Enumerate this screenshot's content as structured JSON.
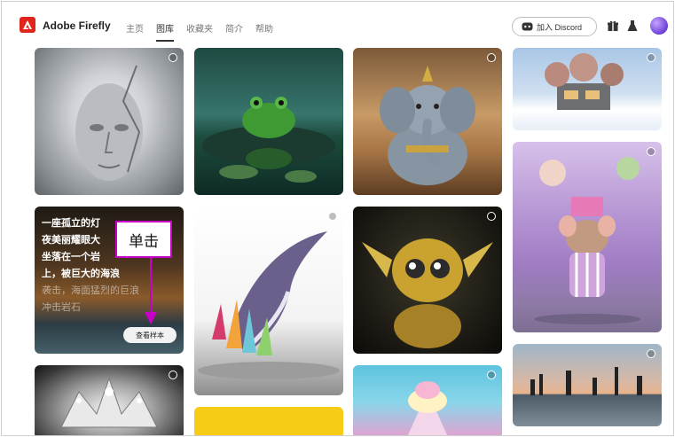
{
  "header": {
    "brand": "Adobe Firefly",
    "nav": [
      {
        "label": "主页",
        "active": false
      },
      {
        "label": "图库",
        "active": true
      },
      {
        "label": "收藏夹",
        "active": false
      },
      {
        "label": "简介",
        "active": false
      },
      {
        "label": "帮助",
        "active": false
      }
    ],
    "discord_label": "加入 Discord"
  },
  "prompt_tile": {
    "lines": [
      "一座孤立的灯",
      "夜美丽耀眼大",
      "坐落在一个岩",
      "上，被巨大的海浪",
      "袭击，海面猛烈的巨浪",
      "冲击岩石"
    ],
    "view_sample_label": "查看样本"
  },
  "callout": {
    "text": "单击"
  },
  "colors": {
    "accent": "#e1251b",
    "callout_border": "#c800c8"
  }
}
